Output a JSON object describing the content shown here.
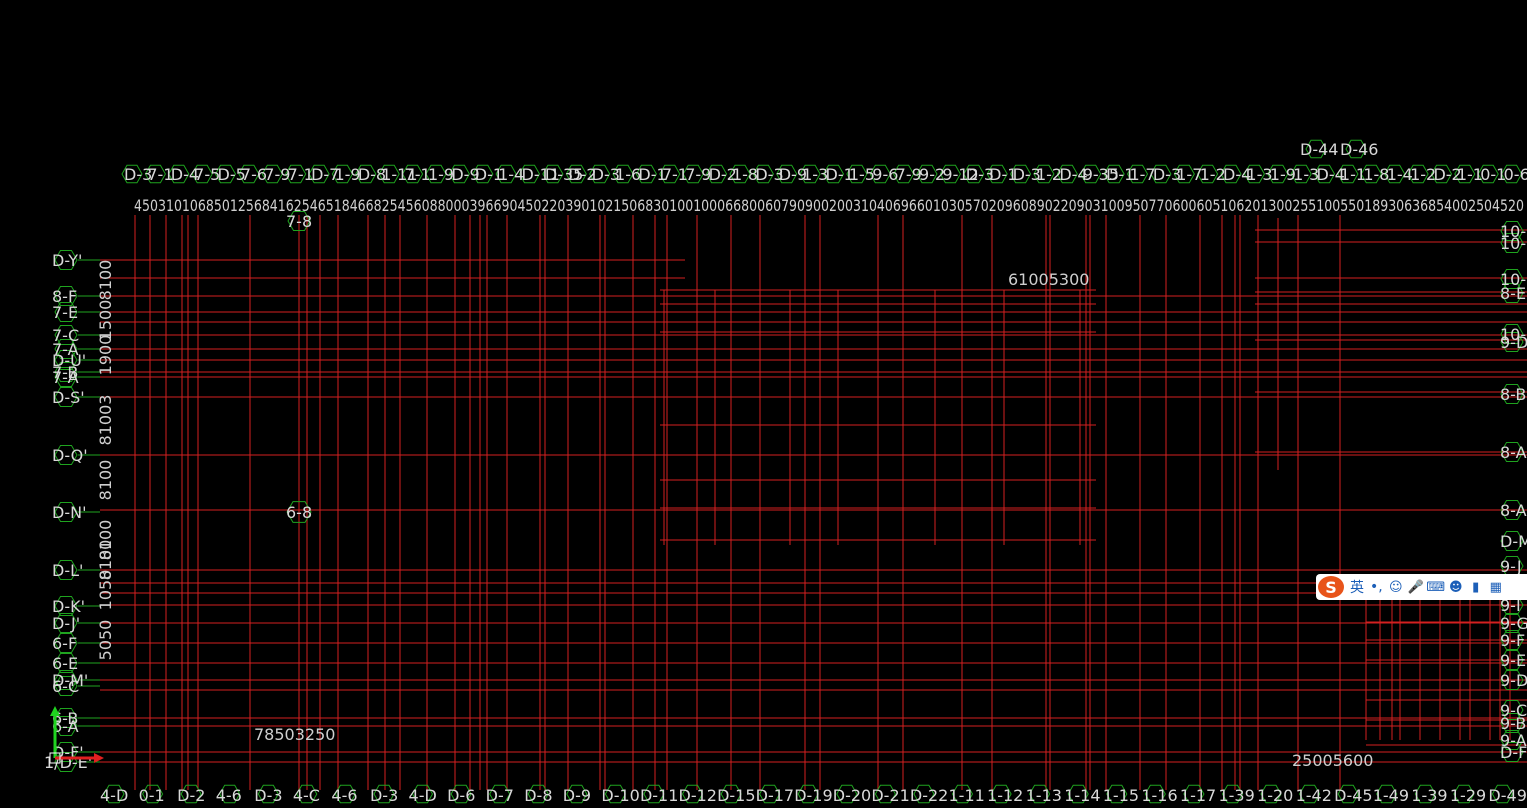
{
  "top_labels": [
    "D-3",
    "7-1",
    "D-4",
    "7-5",
    "D-5",
    "7-6",
    "7-9",
    "7-1",
    "D-7",
    "1-9",
    "D-8",
    "1-11",
    "7-1",
    "1-9",
    "D-9",
    "D-1",
    "1-4",
    "D-11",
    "D-35",
    "D-2",
    "D-3",
    "1-6",
    "D-1",
    "7-1",
    "7-9",
    "D-2",
    "1-8",
    "D-3",
    "D-9",
    "1-3",
    "D-1",
    "1-5",
    "9-6",
    "7-9",
    "9-2",
    "9-12",
    "D-3",
    "D-1",
    "D-3",
    "1-2",
    "D-4",
    "9-35",
    "D-1",
    "1-7",
    "D-3",
    "1-7",
    "1-2",
    "D-4",
    "1-3",
    "1-9",
    "1-3",
    "D-4",
    "1-1",
    "1-8",
    "1-4",
    "1-2",
    "D-2",
    "1-1",
    "0-1",
    "0-62"
  ],
  "top_dims": "450310106850125684162546518466825456088000396690450220390102150683010010006680060790900200310406966010305702096089022090310095077060060510620130025510055018930636854002504520",
  "upper_top_labels": [
    "D-44",
    "D-46"
  ],
  "sub_label_7_8": "7-8",
  "left_labels": [
    "D-Y'",
    "8-F",
    "7-E",
    "7-C",
    "7-A",
    "D-U'",
    "7-B",
    "7-A",
    "D-S'",
    "D-Q'",
    "D-N'",
    "D-L'",
    "D-K'",
    "D-J'",
    "6-F",
    "6-E",
    "D-M'",
    "6-C",
    "6-B",
    "6-A",
    "D-F'",
    "1/D-E'"
  ],
  "left_dims": [
    "8100",
    "1500",
    "1900",
    "81003",
    "8100",
    "8100",
    "8100",
    "1050",
    "5050"
  ],
  "bottom_labels": [
    "4-D",
    "0-1",
    "D-2",
    "4-6",
    "D-3",
    "4-C",
    "4-6",
    "D-3",
    "4-D",
    "D-6",
    "D-7",
    "D-8",
    "D-9",
    "D-10",
    "D-11",
    "D-12",
    "D-15",
    "D-17",
    "D-19",
    "D-20",
    "D-21",
    "D-22",
    "1-11",
    "1-12",
    "1-13",
    "1-14",
    "1-15",
    "1-16",
    "1-17",
    "1-39",
    "1-20",
    "1-42",
    "D-45",
    "1-49",
    "1-39",
    "1-29",
    "D-49"
  ],
  "bottom_readable": [
    "D-6",
    "D-7",
    "D-8",
    "1-11",
    "1-12",
    "1-13",
    "1-14",
    "1-15",
    "1-16"
  ],
  "bubble_6_8": "6-8",
  "bubble_7_8": "7-8",
  "dim_6100": "61005300",
  "dim_7850": "78503250",
  "dim_2500": "25005600",
  "right_labels": [
    "10-",
    "10-",
    "10-",
    "8-E",
    "10-",
    "9-D",
    "8-B",
    "8-A",
    "8-A",
    "D-M",
    "9-J",
    "9-I",
    "9-G",
    "9-F",
    "9-E",
    "9-D",
    "9-C",
    "9-B",
    "9-A",
    "D-F"
  ],
  "ime": {
    "logo": "S",
    "lang": "英",
    "punct": "•,",
    "icons": [
      "smile-icon",
      "mic-icon",
      "keyboard-icon",
      "user-icon",
      "shirt-icon",
      "grid-icon"
    ]
  },
  "colors": {
    "background": "#000000",
    "grid_line": "#d42020",
    "bubble": "#1fa31f",
    "text": "#d9d9d9"
  }
}
